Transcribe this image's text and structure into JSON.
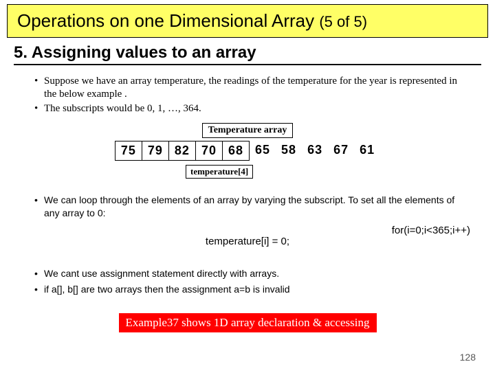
{
  "title": {
    "main": "Operations on one Dimensional Array ",
    "sub": "(5 of 5)"
  },
  "section": "5. Assigning values to an array",
  "serif_bullets": [
    "Suppose we have an array temperature, the readings of the temperature for the year is represented in the below example .",
    "The subscripts would be 0, 1, …, 364."
  ],
  "array": {
    "caption": "Temperature array",
    "values": [
      "75",
      "79",
      "82",
      "70",
      "68",
      "65",
      "58",
      "63",
      "67",
      "61"
    ],
    "boxed_count": 5,
    "index_label": "temperature[4]"
  },
  "sans_bullets_a": [
    "We can loop through the elements of an array by varying the subscript. To set all the elements of any array to 0:"
  ],
  "for_loop": "for(i=0;i<365;i++)",
  "stmt": "temperature[i] = 0;",
  "sans_bullets_b": [
    "We cant use assignment statement directly with arrays.",
    ""
  ],
  "invalid_line": "if a[], b[] are two arrays then the assignment  a=b is invalid",
  "note": "Example37 shows 1D array declaration & accessing",
  "page": "128"
}
